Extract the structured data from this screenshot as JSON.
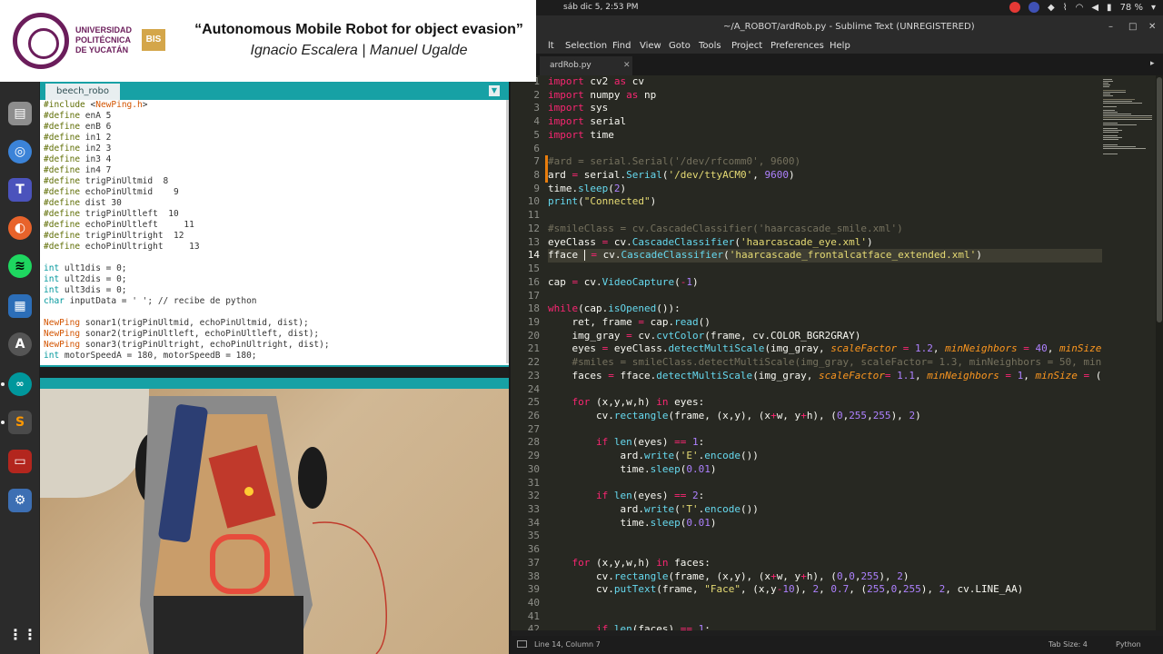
{
  "topbar": {
    "clock": "sáb dic  5,  2:53 PM",
    "battery": "78 %"
  },
  "banner": {
    "university": "UNIVERSIDAD\nPOLITÉCNICA\nDE YUCATÁN",
    "badge": "BIS",
    "title": "“Autonomous Mobile Robot for object evasion”",
    "subtitle": "Ignacio Escalera | Manuel Ugalde"
  },
  "dock": {
    "items": [
      "files-icon",
      "chromium-icon",
      "teams-icon",
      "firefox-icon",
      "spotify-icon",
      "document-viewer-icon",
      "app-center-icon",
      "arduino-icon",
      "sublime-text-icon",
      "terminal-icon",
      "settings-icon",
      "show-apps-icon"
    ]
  },
  "arduino": {
    "tab": "beech_robo",
    "code": [
      "#include <NewPing.h>",
      "#define enA 5",
      "#define enB 6",
      "#define in1 2",
      "#define in2 3",
      "#define in3 4",
      "#define in4 7",
      "#define trigPinUltmid  8",
      "#define echoPinUltmid    9",
      "#define dist 30",
      "#define trigPinUltleft  10",
      "#define echoPinUltleft     11",
      "#define trigPinUltright  12",
      "#define echoPinUltright     13",
      "",
      "int ult1dis = 0;",
      "int ult2dis = 0;",
      "int ult3dis = 0;",
      "char inputData = ' '; // recibe de python",
      "",
      "NewPing sonar1(trigPinUltmid, echoPinUltmid, dist);",
      "NewPing sonar2(trigPinUltleft, echoPinUltleft, dist);",
      "NewPing sonar3(trigPinUltright, echoPinUltright, dist);",
      "int motorSpeedA = 180, motorSpeedB = 180;"
    ]
  },
  "sublime": {
    "title": "~/A_ROBOT/ardRob.py - Sublime Text (UNREGISTERED)",
    "menu": [
      "lt",
      "Selection",
      "Find",
      "View",
      "Goto",
      "Tools",
      "Project",
      "Preferences",
      "Help"
    ],
    "tab": "ardRob.py",
    "first_line": 1,
    "current_line": 14,
    "code_html": [
      "<span class='k'>import</span> cv2 <span class='k'>as</span> cv",
      "<span class='k'>import</span> numpy <span class='k'>as</span> np",
      "<span class='k'>import</span> sys",
      "<span class='k'>import</span> serial",
      "<span class='k'>import</span> time",
      "",
      "<span class='c'>#ard = serial.Serial('/dev/rfcomm0', 9600)</span>",
      "ard <span class='k'>=</span> serial.<span class='f'>Serial</span>(<span class='s'>'/dev/ttyACM0'</span>, <span class='n'>9600</span>)",
      "time.<span class='f'>sleep</span>(<span class='n'>2</span>)",
      "<span class='f'>print</span>(<span class='s'>\"Connected\"</span>)",
      "",
      "<span class='c'>#smileClass = cv.CascadeClassifier('haarcascade_smile.xml')</span>",
      "eyeClass <span class='k'>=</span> cv.<span class='f'>CascadeClassifier</span>(<span class='s'>'haarcascade_eye.xml'</span>)",
      "fface <span class='cursor'></span> <span class='k'>=</span> cv.<span class='f'>CascadeClassifier</span>(<span class='s'>'haarcascade_frontalcatface_extended.xml'</span>)",
      "",
      "cap <span class='k'>=</span> cv.<span class='f'>VideoCapture</span>(<span class='k'>-</span><span class='n'>1</span>)",
      "",
      "<span class='k'>while</span>(cap.<span class='f'>isOpened</span>()):",
      "    ret, frame <span class='k'>=</span> cap.<span class='f'>read</span>()",
      "    img_gray <span class='k'>=</span> cv.<span class='f'>cvtColor</span>(frame, cv.COLOR_BGR2GRAY)",
      "    eyes <span class='k'>=</span> eyeClass.<span class='f'>detectMultiScale</span>(img_gray, <span class='p'>scaleFactor</span> <span class='k'>=</span> <span class='n'>1.2</span>, <span class='p'>minNeighbors</span> <span class='k'>=</span> <span class='n'>40</span>, <span class='p'>minSize</span>",
      "    <span class='c'>#smiles = smileClass.detectMultiScale(img_gray, scaleFactor= 1.3, minNeighbors = 50, min</span>",
      "    faces <span class='k'>=</span> fface.<span class='f'>detectMultiScale</span>(img_gray, <span class='p'>scaleFactor</span><span class='k'>=</span> <span class='n'>1.1</span>, <span class='p'>minNeighbors</span> <span class='k'>=</span> <span class='n'>1</span>, <span class='p'>minSize</span> <span class='k'>=</span> (",
      "",
      "    <span class='k'>for</span> (x,y,w,h) <span class='k'>in</span> eyes:",
      "        cv.<span class='f'>rectangle</span>(frame, (x,y), (x<span class='k'>+</span>w, y<span class='k'>+</span>h), (<span class='n'>0</span>,<span class='n'>255</span>,<span class='n'>255</span>), <span class='n'>2</span>)",
      "",
      "        <span class='k'>if</span> <span class='f'>len</span>(eyes) <span class='k'>==</span> <span class='n'>1</span>:",
      "            ard.<span class='f'>write</span>(<span class='s'>'E'</span>.<span class='f'>encode</span>())",
      "            time.<span class='f'>sleep</span>(<span class='n'>0.01</span>)",
      "",
      "        <span class='k'>if</span> <span class='f'>len</span>(eyes) <span class='k'>==</span> <span class='n'>2</span>:",
      "            ard.<span class='f'>write</span>(<span class='s'>'T'</span>.<span class='f'>encode</span>())",
      "            time.<span class='f'>sleep</span>(<span class='n'>0.01</span>)",
      "",
      "",
      "    <span class='k'>for</span> (x,y,w,h) <span class='k'>in</span> faces:",
      "        cv.<span class='f'>rectangle</span>(frame, (x,y), (x<span class='k'>+</span>w, y<span class='k'>+</span>h), (<span class='n'>0</span>,<span class='n'>0</span>,<span class='n'>255</span>), <span class='n'>2</span>)",
      "        cv.<span class='f'>putText</span>(frame, <span class='s'>\"Face\"</span>, (x,y<span class='k'>-</span><span class='n'>10</span>), <span class='n'>2</span>, <span class='n'>0.7</span>, (<span class='n'>255</span>,<span class='n'>0</span>,<span class='n'>255</span>), <span class='n'>2</span>, cv.LINE_AA)",
      "",
      "",
      "        <span class='k'>if</span> <span class='f'>len</span>(faces) <span class='k'>==</span> <span class='n'>1</span>:"
    ],
    "modified_lines": [
      7,
      8
    ],
    "status": {
      "position": "Line 14, Column 7",
      "tab_size": "Tab Size: 4",
      "syntax": "Python"
    }
  },
  "colors": {
    "banner_accent": "#6b1d5b",
    "badge": "#d4a64a",
    "arduino_teal": "#17a1a5",
    "editor_bg": "#272822"
  }
}
